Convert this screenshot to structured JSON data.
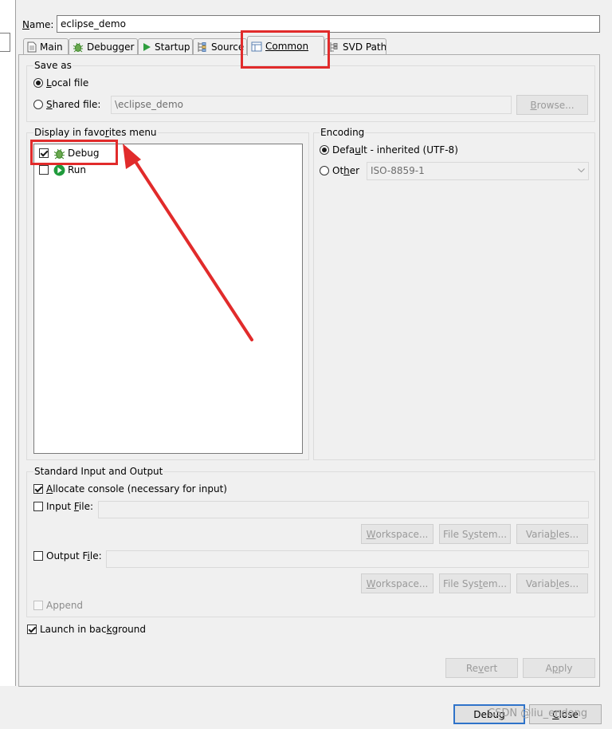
{
  "name": {
    "label": "Name:",
    "value": "eclipse_demo"
  },
  "tabs": [
    {
      "label": "Main",
      "icon": "document-icon"
    },
    {
      "label": "Debugger",
      "icon": "bug-icon"
    },
    {
      "label": "Startup",
      "icon": "play-icon"
    },
    {
      "label": "Source",
      "icon": "source-icon"
    },
    {
      "label": "Common",
      "icon": "common-icon"
    },
    {
      "label": "SVD Path",
      "icon": "svd-icon"
    }
  ],
  "save_as": {
    "title": "Save as",
    "local_file": "Local file",
    "shared_file": "Shared file:",
    "shared_path": "\\eclipse_demo",
    "browse": "Browse..."
  },
  "favorites": {
    "title": "Display in favorites menu",
    "items": [
      {
        "label": "Debug",
        "checked": true
      },
      {
        "label": "Run",
        "checked": false
      }
    ]
  },
  "encoding": {
    "title": "Encoding",
    "default_label": "Default - inherited (UTF-8)",
    "other_label": "Other",
    "other_value": "ISO-8859-1"
  },
  "stdio": {
    "title": "Standard Input and Output",
    "allocate_console": "Allocate console (necessary for input)",
    "input_file": "Input File:",
    "output_file": "Output File:",
    "workspace": "Workspace...",
    "file_system": "File System...",
    "variables": "Variables...",
    "append": "Append"
  },
  "launch_background": "Launch in background",
  "buttons": {
    "revert": "Revert",
    "apply": "Apply",
    "debug": "Debug",
    "close": "Close"
  },
  "watermark": "CSDN @liu_endong",
  "colors": {
    "annotation_red": "#e12b2b",
    "focus_blue": "#2f73c9",
    "run_green": "#1f9b3c",
    "bug_green": "#3f8a2d"
  }
}
